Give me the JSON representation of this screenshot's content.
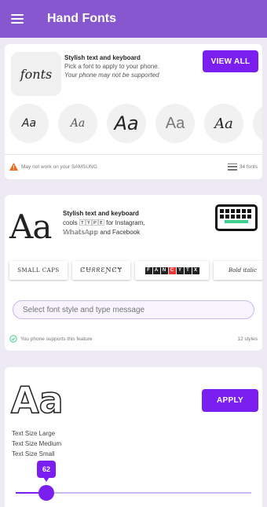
{
  "app": {
    "title": "Hand Fonts"
  },
  "card1": {
    "logo_text": "fonts",
    "title": "Stylish text and keyboard",
    "description": "Pick a font to apply to your phone.",
    "warning": "Your phone may not be supported",
    "view_all_label": "VIEW ALL",
    "previews": [
      "Aa",
      "Aa",
      "Aa",
      "Aa",
      "Aa"
    ],
    "footer_warning": "May not work on your SAMSUNG",
    "font_count": "34 fonts",
    "warning_color": "#f26b1d"
  },
  "card2": {
    "big_sample": "Aa",
    "title": "Stylish text and keyboard",
    "line2": "cools 🅃🅈🄿🄴 for Instagram,",
    "line3": "𝕎𝕙𝕒𝕥𝕤𝔸𝕡𝕡 and Facebook",
    "styles": [
      "SMALL CAPS",
      "ȻɄᖇᖇƐƝȻɎ",
      "",
      "Bold italic"
    ],
    "boxed_letters": [
      "F",
      "A",
      "N",
      "C",
      "Y",
      "T",
      "X"
    ],
    "input_placeholder": "Select font style and type message",
    "support_text": "You phone supports this feature",
    "styles_count": "12 styles",
    "accent_color": "#3fcf8e"
  },
  "card3": {
    "sample": "Aa",
    "apply_label": "APPLY",
    "sizes": [
      "Text Size Large",
      "Text Size Medium",
      "Text Size Small"
    ],
    "slider_value": "62",
    "slider_fraction": 0.15
  },
  "colors": {
    "appbar": "#8657cf",
    "primary": "#7a1ff0",
    "background": "#eeeaf3"
  },
  "icons": {
    "menu": "menu-icon",
    "warning": "warning-icon",
    "list": "list-icon",
    "keyboard": "keyboard-icon",
    "check": "check-circle-icon"
  }
}
